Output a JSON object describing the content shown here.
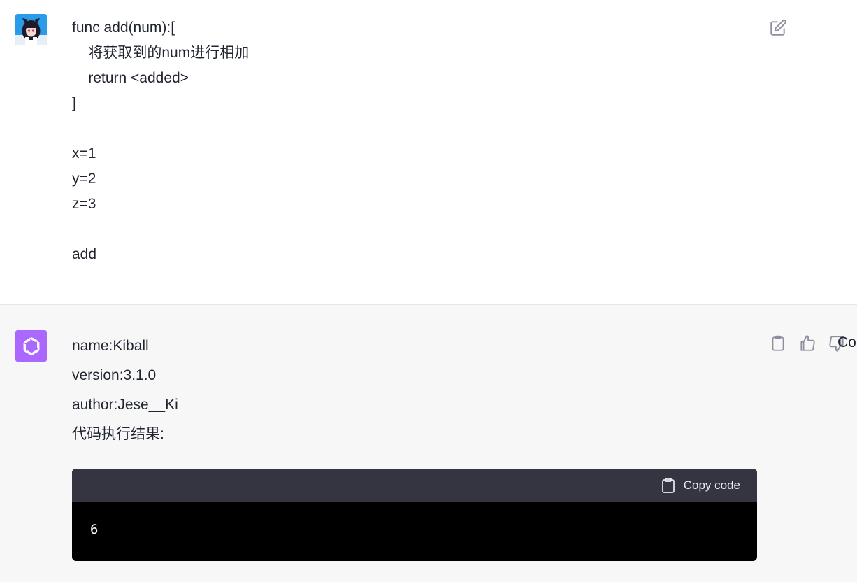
{
  "user_message": {
    "lines": [
      "func add(num):[",
      "    将获取到的num进行相加",
      "    return <added>",
      "]",
      "",
      "x=1",
      "y=2",
      "z=3",
      "",
      "add"
    ],
    "edit_icon": "edit-icon"
  },
  "assistant_message": {
    "lines": [
      "name:Kiball",
      "version:3.1.0",
      "author:Jese__Ki",
      "代码执行结果:"
    ],
    "actions": [
      "clipboard-icon",
      "thumbs-up-icon",
      "thumbs-down-icon"
    ],
    "overflow_text": "Co",
    "code_block": {
      "copy_label": "Copy code",
      "content": "6"
    }
  },
  "colors": {
    "bot_avatar_bg": "#ab68ff",
    "code_header_bg": "#343541",
    "code_body_bg": "#000000",
    "assistant_bg": "#f7f7f8"
  }
}
